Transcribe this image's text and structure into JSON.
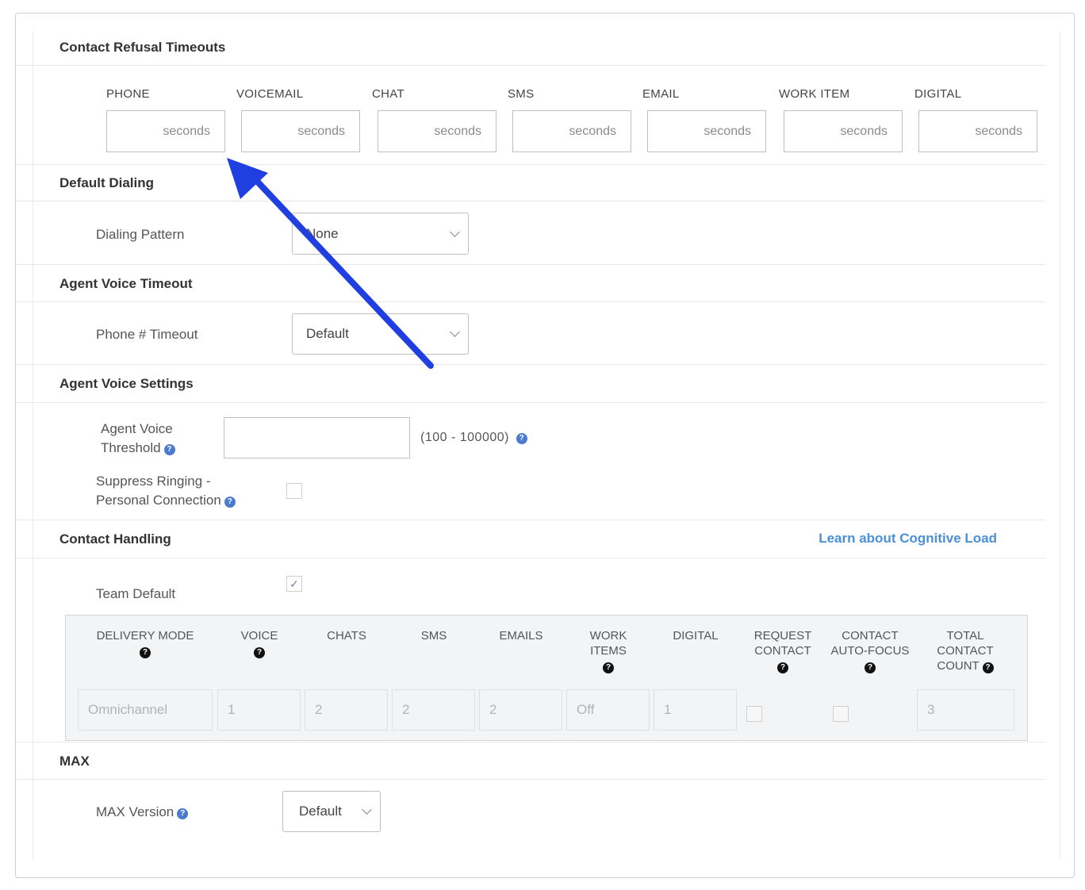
{
  "refusal": {
    "title": "Contact Refusal Timeouts",
    "columns": [
      "PHONE",
      "VOICEMAIL",
      "CHAT",
      "SMS",
      "EMAIL",
      "WORK ITEM",
      "DIGITAL"
    ],
    "placeholder": "seconds"
  },
  "dialing": {
    "title": "Default Dialing",
    "pattern_label": "Dialing Pattern",
    "pattern_value": "None"
  },
  "voice_timeout": {
    "title": "Agent Voice Timeout",
    "label": "Phone # Timeout",
    "value": "Default"
  },
  "voice_settings": {
    "title": "Agent Voice Settings",
    "threshold_label_1": "Agent Voice",
    "threshold_label_2": "Threshold",
    "threshold_value": "",
    "range": "(100 - 100000)",
    "suppress_label_1": "Suppress Ringing -",
    "suppress_label_2": "Personal Connection",
    "suppress_checked": false
  },
  "contact_handling": {
    "title": "Contact Handling",
    "learn_link": "Learn about Cognitive Load",
    "team_default_label": "Team Default",
    "team_default_check": "✓",
    "headers": {
      "delivery_mode": "DELIVERY MODE",
      "voice": "VOICE",
      "chats": "CHATS",
      "sms": "SMS",
      "emails": "EMAILS",
      "work_items_1": "WORK",
      "work_items_2": "ITEMS",
      "digital": "DIGITAL",
      "request_1": "REQUEST",
      "request_2": "CONTACT",
      "autofocus_1": "CONTACT",
      "autofocus_2": "AUTO-FOCUS",
      "total_1": "TOTAL",
      "total_2": "CONTACT",
      "total_3": "COUNT"
    },
    "values": {
      "delivery_mode": "Omnichannel",
      "voice": "1",
      "chats": "2",
      "sms": "2",
      "emails": "2",
      "work_items": "Off",
      "digital": "1",
      "request_contact": false,
      "contact_autofocus": false,
      "total": "3"
    }
  },
  "max": {
    "title": "MAX",
    "version_label": "MAX Version",
    "version_value": "Default"
  },
  "icons": {
    "help": "?",
    "arrow_color": "#1f3fe0",
    "link_color": "#4a90d9"
  }
}
